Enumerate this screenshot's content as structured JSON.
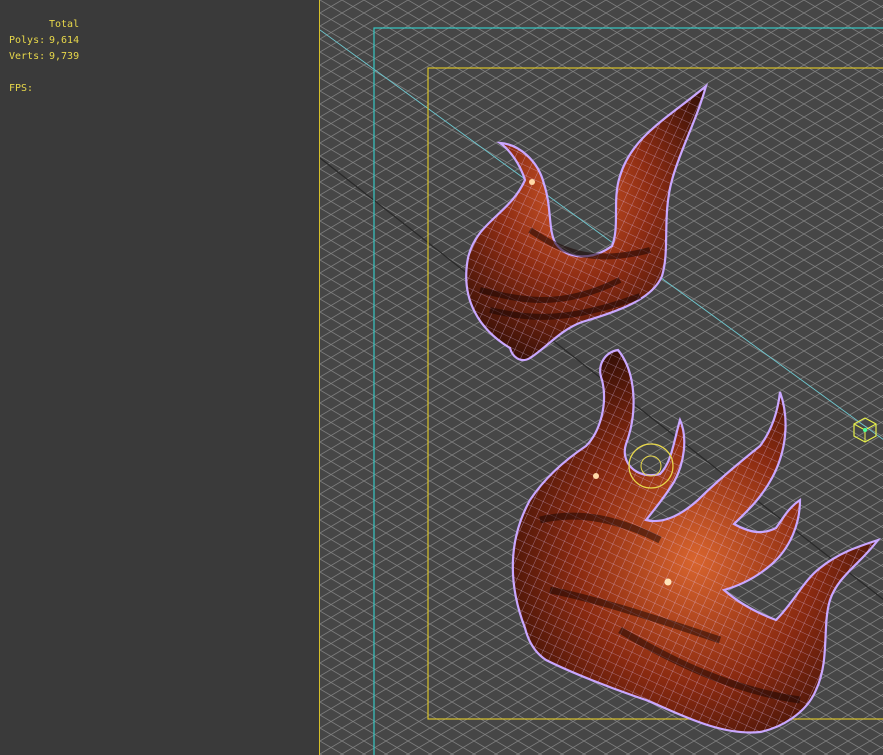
{
  "stats": {
    "top_clip": "— — —",
    "title": "Total",
    "polys_label": "Polys:",
    "polys_value": "9,614",
    "verts_label": "Verts:",
    "verts_value": "9,739",
    "fps_label": "FPS:"
  },
  "colors": {
    "panel_bg": "#3a3a3a",
    "viewport_bg": "#464646",
    "stat_text": "#e8d84a",
    "grid_line": "#8a8a8a",
    "safe_frame_outer": "#36c9c4",
    "safe_frame_inner": "#d7c12a",
    "wire": "#c9a7ff",
    "mesh_fill": "#8a2c12"
  },
  "viewport": {
    "view": "3D perspective",
    "objects": [
      "flame-mesh-small",
      "flame-mesh-large",
      "light-gizmo",
      "camera-target"
    ]
  }
}
